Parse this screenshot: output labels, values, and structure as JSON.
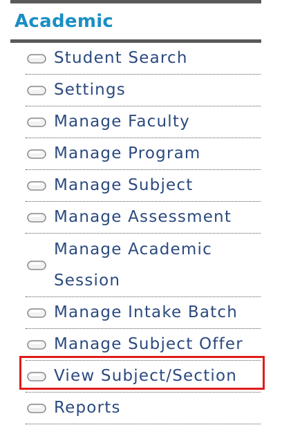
{
  "sidebar": {
    "title": "Academic",
    "items": [
      {
        "label": "Student Search"
      },
      {
        "label": "Settings"
      },
      {
        "label": "Manage Faculty"
      },
      {
        "label": "Manage Program"
      },
      {
        "label": "Manage Subject"
      },
      {
        "label": "Manage Assessment"
      },
      {
        "label": "Manage Academic Session"
      },
      {
        "label": "Manage Intake Batch"
      },
      {
        "label": "Manage Subject Offer"
      },
      {
        "label": "View Subject/Section"
      },
      {
        "label": "Reports"
      }
    ],
    "item_icon": "pill-bullet-icon",
    "highlighted_item": "View Subject/Section",
    "colors": {
      "title": "#1a8fc4",
      "item_text": "#2b4a7e",
      "rule": "#5a5a5a",
      "highlight": "#e01b1b"
    }
  }
}
